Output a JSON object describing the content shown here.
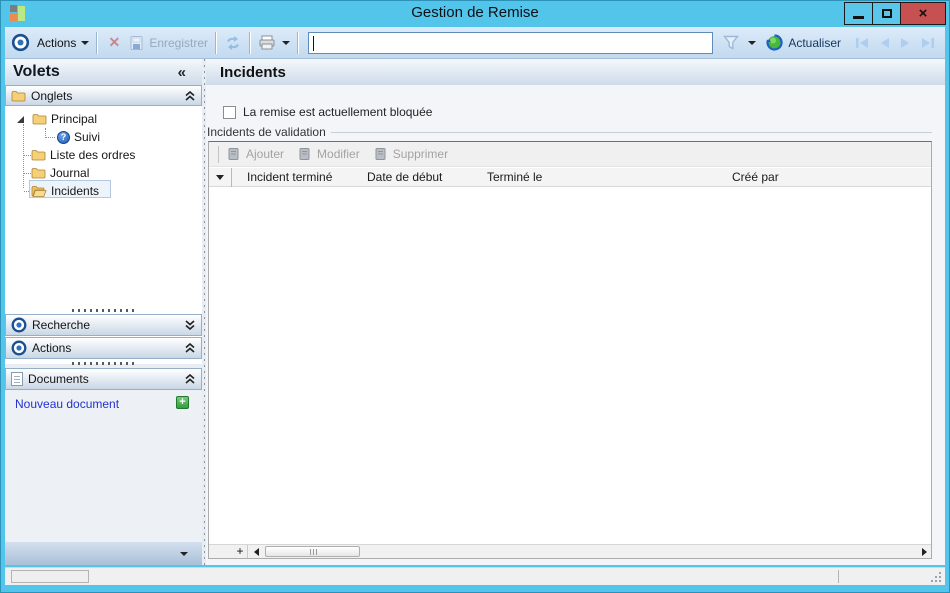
{
  "window": {
    "title": "Gestion de Remise"
  },
  "titlebar": {
    "close_glyph": "×"
  },
  "toolbar": {
    "actions_label": "Actions",
    "enregistrer_label": "Enregistrer",
    "search_value": "",
    "actualiser_label": "Actualiser"
  },
  "sidebar": {
    "title": "Volets",
    "collapse_glyph": "«",
    "sections": {
      "onglets": "Onglets",
      "recherche": "Recherche",
      "actions": "Actions",
      "documents": "Documents"
    },
    "tree": [
      {
        "label": "Principal",
        "icon": "folder",
        "expanded": true
      },
      {
        "label": "Suivi",
        "icon": "help-circle",
        "help_glyph": "?"
      },
      {
        "label": "Liste des ordres",
        "icon": "folder"
      },
      {
        "label": "Journal",
        "icon": "folder"
      },
      {
        "label": "Incidents",
        "icon": "folder-open",
        "selected": true
      }
    ],
    "documents": {
      "new_document_label": "Nouveau document",
      "plus_glyph": "+"
    }
  },
  "main": {
    "title": "Incidents",
    "blocked_checkbox": {
      "label": "La remise est actuellement bloquée",
      "checked": false
    },
    "groupbox_label": "Incidents de validation",
    "grid_toolbar": {
      "ajouter": "Ajouter",
      "modifier": "Modifier",
      "supprimer": "Supprimer"
    },
    "table": {
      "columns": [
        "Incident terminé",
        "Date de début",
        "Terminé le",
        "Créé par"
      ],
      "rows": []
    },
    "hscrollbar": {
      "add_glyph": "+"
    }
  },
  "colors": {
    "titlebar_blue": "#53c4ea",
    "close_red": "#c75050",
    "link_blue": "#2431cd",
    "disabled_text": "#97a9bc",
    "selection_bg": "#edf3fb",
    "folder_yellow": "#f5d079"
  }
}
